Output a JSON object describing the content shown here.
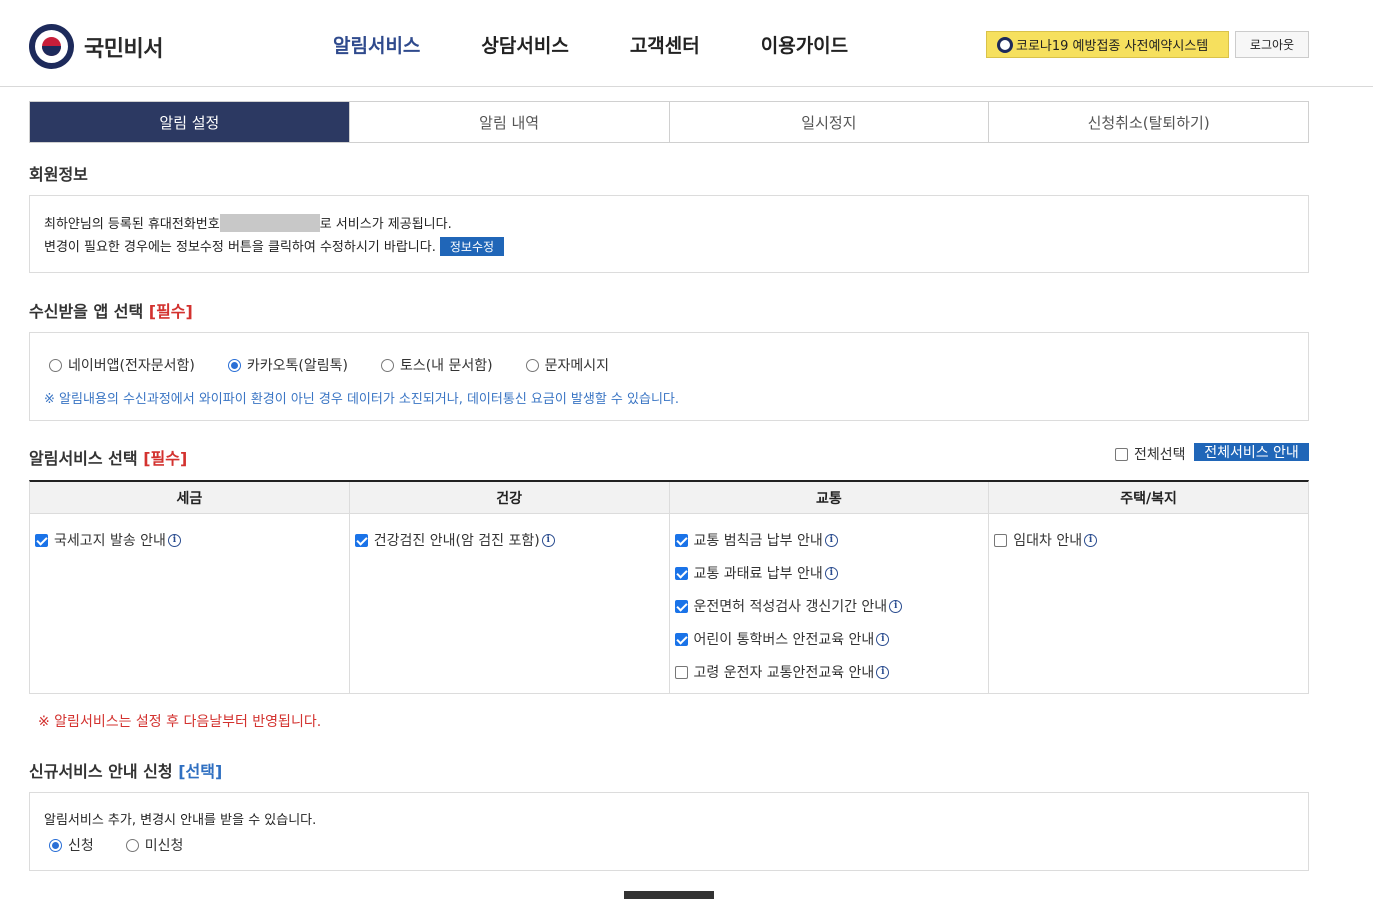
{
  "header": {
    "logo_text": "국민비서",
    "nav": [
      "알림서비스",
      "상담서비스",
      "고객센터",
      "이용가이드"
    ],
    "covid_button": "코로나19 예방접종 사전예약시스템",
    "logout_button": "로그아웃"
  },
  "tabs": [
    "알림 설정",
    "알림 내역",
    "일시정지",
    "신청취소(탈퇴하기)"
  ],
  "member": {
    "title": "회원정보",
    "line1_prefix": "최하얀님의 등록된 휴대전화번호",
    "line1_suffix": "로 서비스가 제공됩니다.",
    "line2": "변경이 필요한 경우에는 정보수정 버튼을 클릭하여 수정하시기 바랍니다.",
    "edit_button": "정보수정"
  },
  "app_select": {
    "title": "수신받을 앱 선택",
    "required": "[필수]",
    "options": [
      "네이버앱(전자문서함)",
      "카카오톡(알림톡)",
      "토스(내 문서함)",
      "문자메시지"
    ],
    "selected_index": 1,
    "notice": "※ 알림내용의 수신과정에서 와이파이 환경이 아닌 경우 데이터가 소진되거나, 데이터통신 요금이 발생할 수 있습니다."
  },
  "service_select": {
    "title": "알림서비스 선택",
    "required": "[필수]",
    "select_all": "전체선택",
    "all_service_button": "전체서비스 안내",
    "columns": [
      {
        "header": "세금",
        "items": [
          {
            "label": "국세고지 발송 안내",
            "checked": true
          }
        ]
      },
      {
        "header": "건강",
        "items": [
          {
            "label": "건강검진 안내(암 검진 포함)",
            "checked": true
          }
        ]
      },
      {
        "header": "교통",
        "items": [
          {
            "label": "교통 범칙금 납부 안내",
            "checked": true
          },
          {
            "label": "교통 과태료 납부 안내",
            "checked": true
          },
          {
            "label": "운전면허 적성검사 갱신기간 안내",
            "checked": true
          },
          {
            "label": "어린이 통학버스 안전교육 안내",
            "checked": true
          },
          {
            "label": "고령 운전자 교통안전교육 안내",
            "checked": false
          }
        ]
      },
      {
        "header": "주택/복지",
        "items": [
          {
            "label": "임대차 안내",
            "checked": false
          }
        ]
      }
    ],
    "warning": "※ 알림서비스는 설정 후 다음날부터 반영됩니다."
  },
  "new_service": {
    "title": "신규서비스 안내 신청",
    "optional": "[선택]",
    "description": "알림서비스 추가, 변경시 안내를 받을 수 있습니다.",
    "options": [
      "신청",
      "미신청"
    ],
    "selected_index": 0
  },
  "info_icon": "i"
}
